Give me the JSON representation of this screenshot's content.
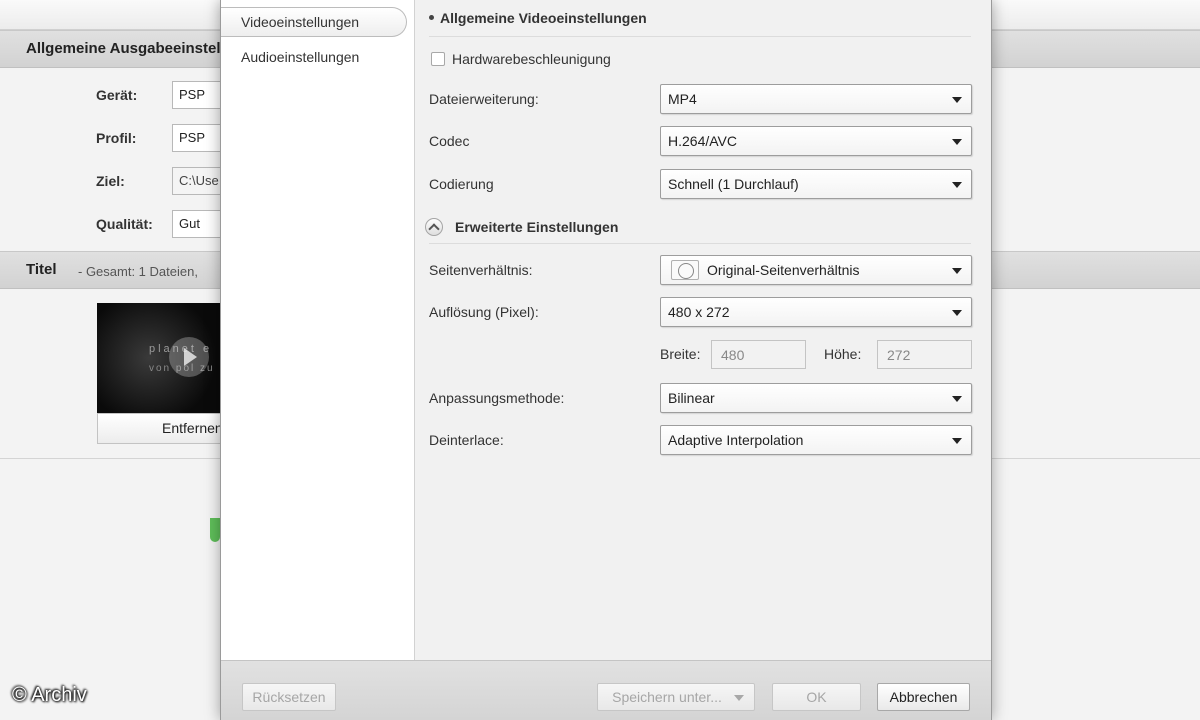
{
  "background_app": {
    "output_section_title": "Allgemeine Ausgabeeinstellungen",
    "fields": [
      {
        "label": "Gerät:",
        "value": "PSP"
      },
      {
        "label": "Profil:",
        "value": "PSP"
      },
      {
        "label": "Ziel:",
        "value": "C:\\Use"
      },
      {
        "label": "Qualität:",
        "value": "Gut"
      }
    ],
    "titles_section": {
      "title": "Titel",
      "summary": "- Gesamt: 1 Dateien,"
    },
    "thumbnail": {
      "line1": "planet e",
      "line2": "von pol zu"
    },
    "remove_button": "Entfernen",
    "watermark": "© Archiv"
  },
  "dialog": {
    "nav": [
      {
        "label": "Videoeinstellungen",
        "active": true
      },
      {
        "label": "Audioeinstellungen",
        "active": false
      }
    ],
    "general_title": "Allgemeine Videoeinstellungen",
    "hardware_acceleration": {
      "label": "Hardwarebeschleunigung",
      "checked": false
    },
    "general_rows": [
      {
        "label": "Dateierweiterung:",
        "value": "MP4"
      },
      {
        "label": "Codec",
        "value": "H.264/AVC"
      },
      {
        "label": "Codierung",
        "value": "Schnell (1 Durchlauf)"
      }
    ],
    "advanced_title": "Erweiterte Einstellungen",
    "aspect_ratio": {
      "label": "Seitenverhältnis:",
      "value": "Original-Seitenverhältnis",
      "icon": "aspect-ratio-icon"
    },
    "resolution": {
      "label": "Auflösung (Pixel):",
      "value": "480 x 272"
    },
    "width": {
      "label": "Breite:",
      "value": "480"
    },
    "height": {
      "label": "Höhe:",
      "value": "272"
    },
    "scaling": {
      "label": "Anpassungsmethode:",
      "value": "Bilinear"
    },
    "deinterlace": {
      "label": "Deinterlace:",
      "value": "Adaptive Interpolation"
    }
  },
  "footer": {
    "reset": "Rücksetzen",
    "save_as": "Speichern unter...",
    "ok": "OK",
    "cancel": "Abbrechen"
  },
  "colors": {
    "dialog_bg": "#f1f1f1",
    "nav_bg": "#ffffff",
    "section_header_bg": "#d8d8d8",
    "disabled_text": "#a6a6a6"
  }
}
